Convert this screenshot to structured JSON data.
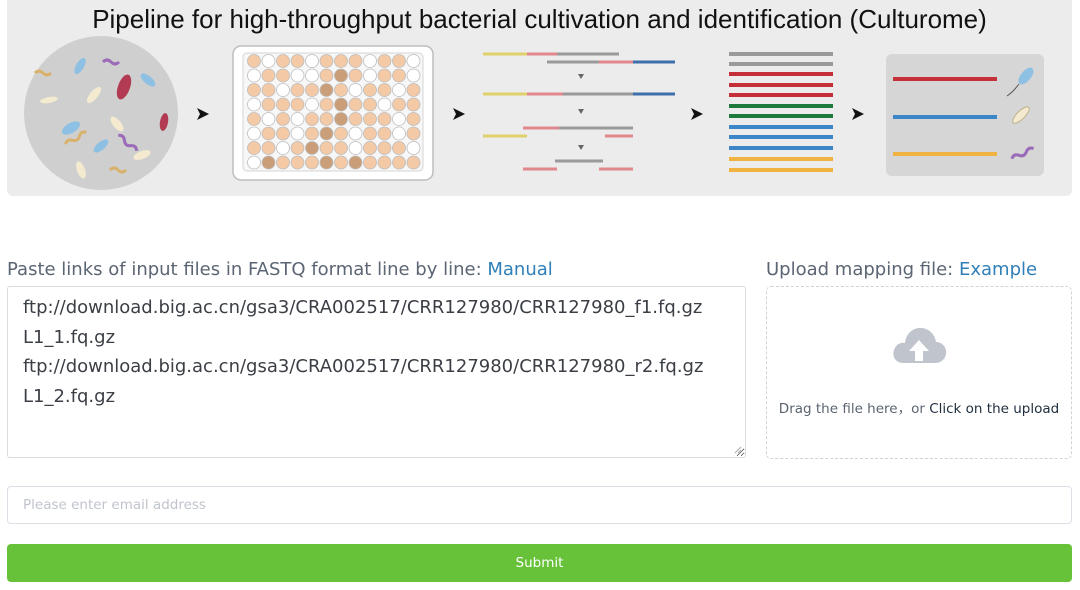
{
  "banner": {
    "title": "Pipeline for high-throughput bacterial cultivation and identification (Culturome)"
  },
  "input_section": {
    "label": "Paste links of input files in FASTQ format line by line:",
    "manual_link": "Manual",
    "lines": [
      "ftp://download.big.ac.cn/gsa3/CRA002517/CRR127980/CRR127980_f1.fq.gz",
      "L1_1.fq.gz",
      "ftp://download.big.ac.cn/gsa3/CRA002517/CRR127980/CRR127980_r2.fq.gz",
      "L1_2.fq.gz"
    ]
  },
  "mapping_section": {
    "label": "Upload mapping file:",
    "example_link": "Example",
    "drag_text": "Drag the file here，or ",
    "click_text": "Click on the upload",
    "icon": "cloud-upload-icon"
  },
  "email": {
    "placeholder": "Please enter email address",
    "value": ""
  },
  "submit": {
    "label": "Submit",
    "color": "#67c23a"
  }
}
